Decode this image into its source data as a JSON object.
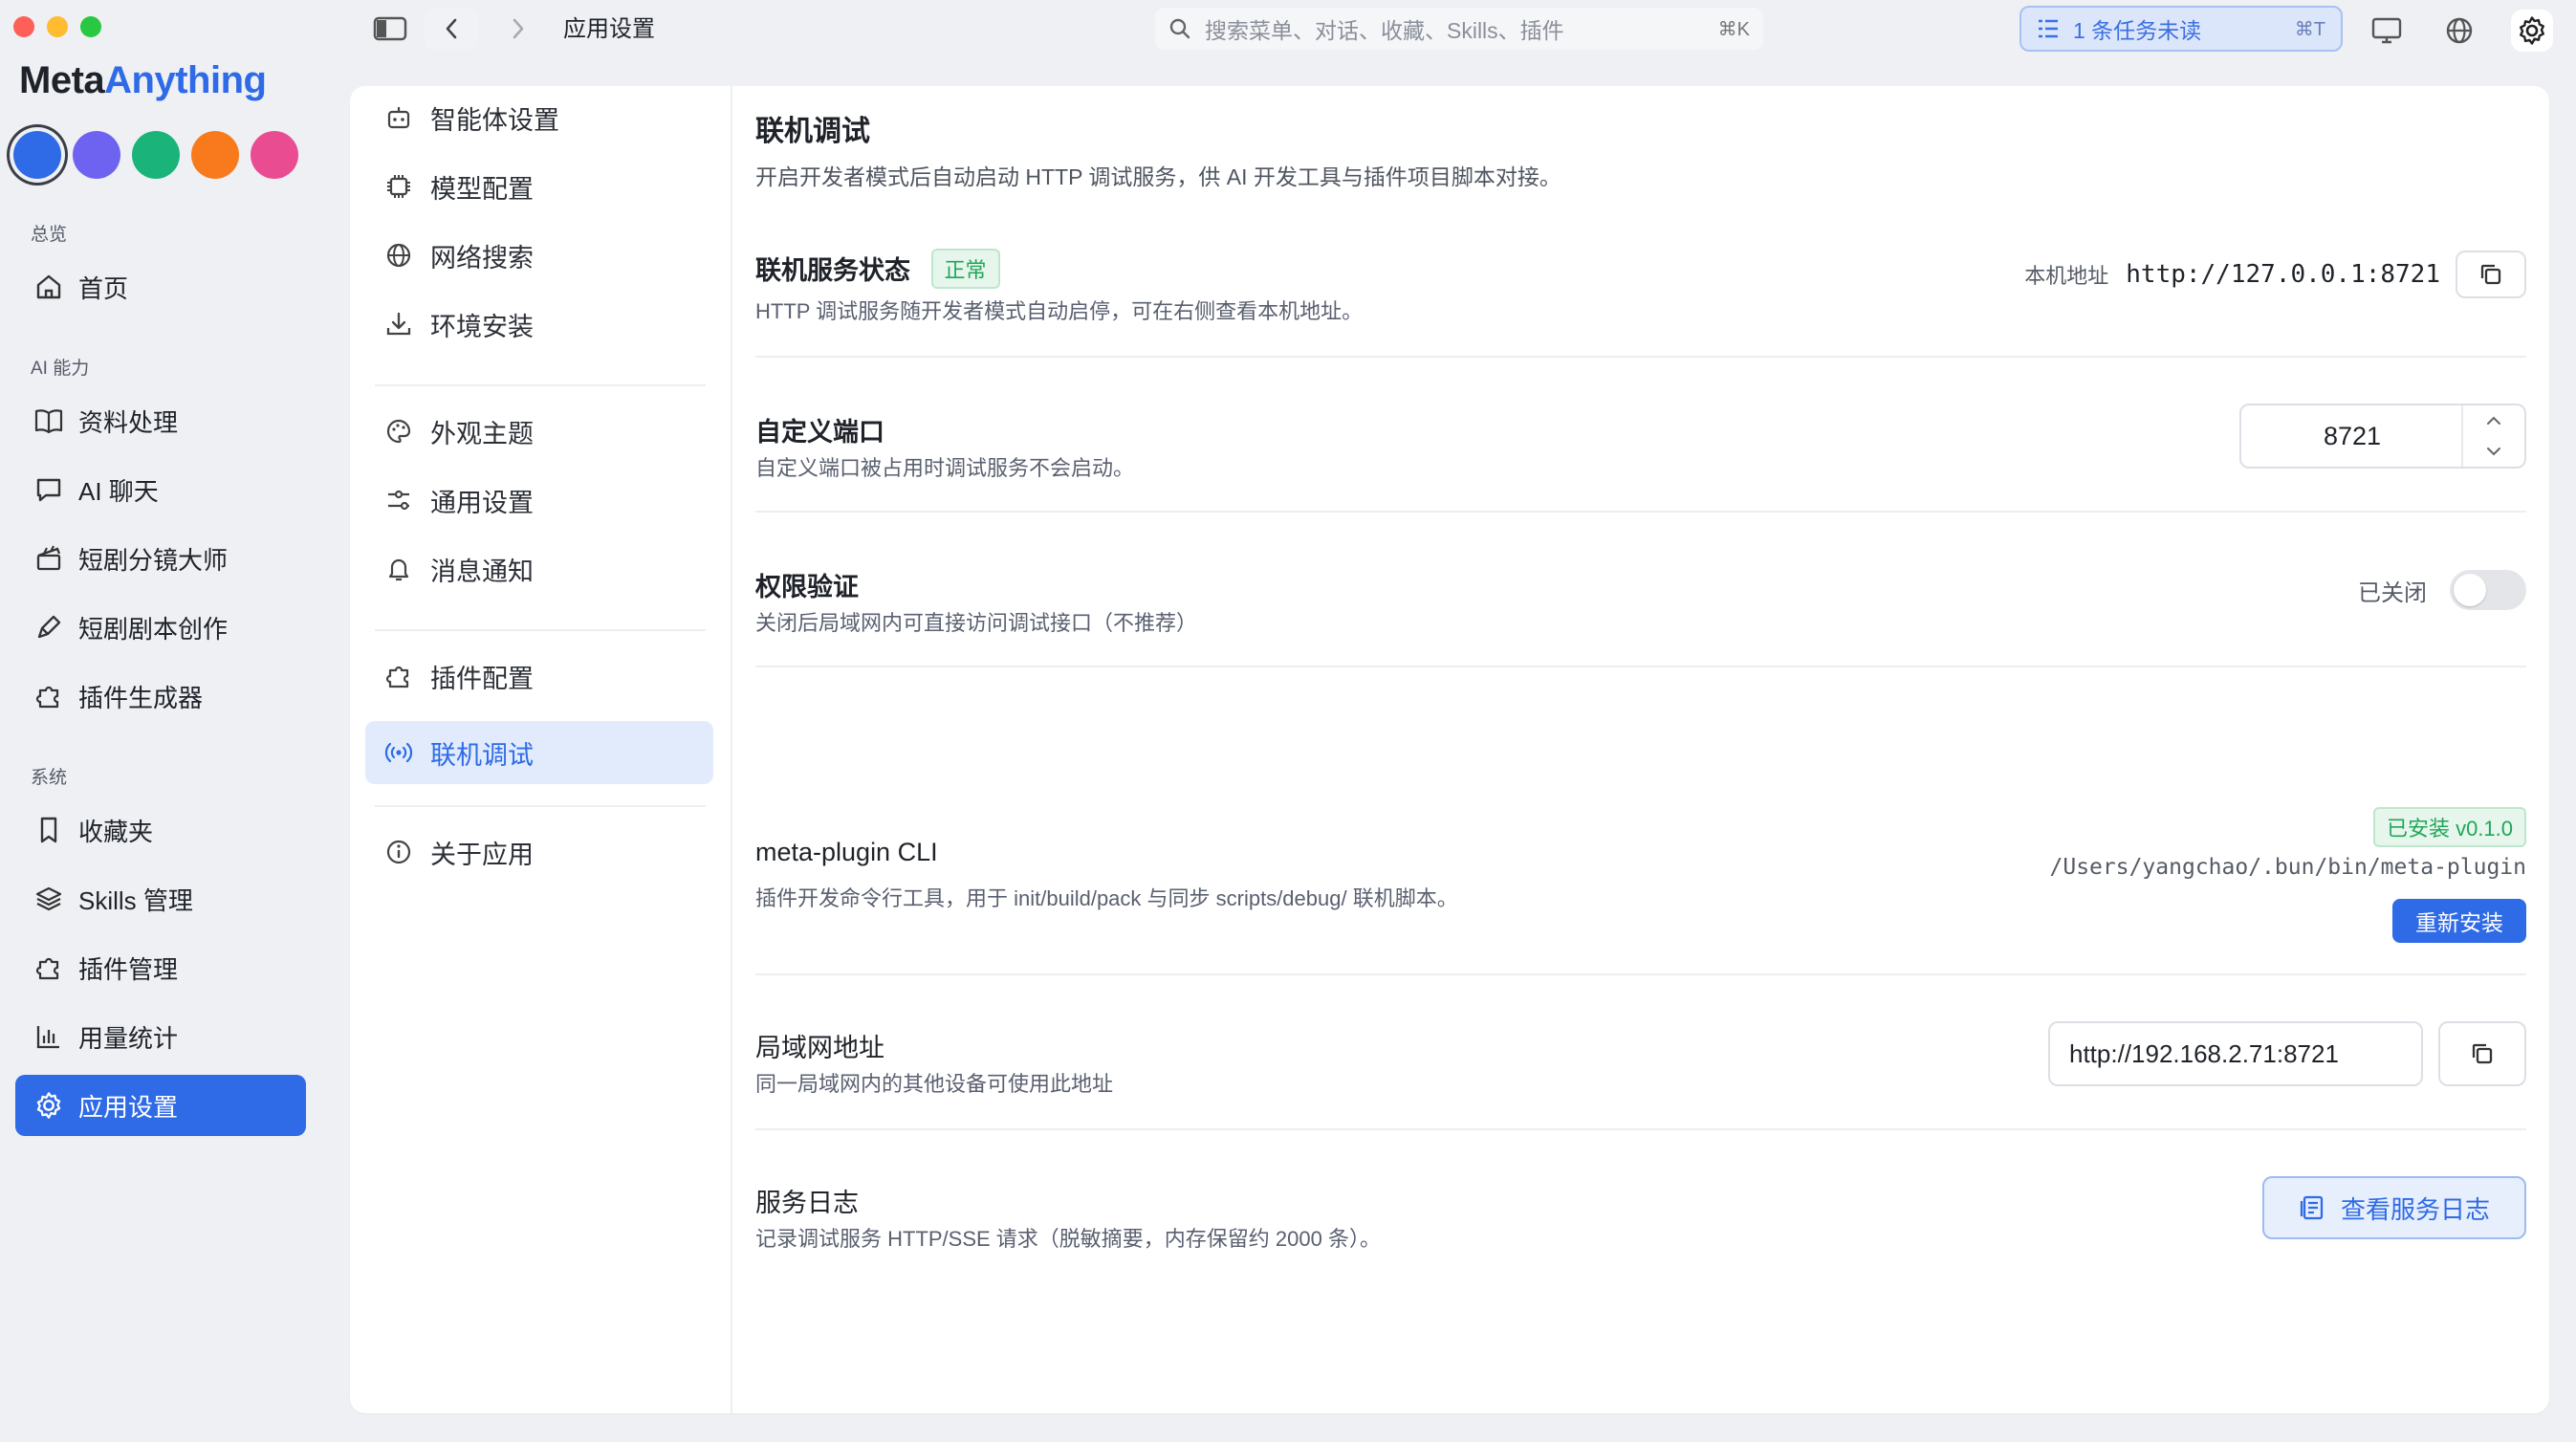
{
  "window": {
    "breadcrumb": "应用设置",
    "search_placeholder": "搜索菜单、对话、收藏、Skills、插件",
    "search_shortcut": "⌘K",
    "tasks_label": "1 条任务未读",
    "tasks_shortcut": "⌘T"
  },
  "brand": {
    "part1": "Meta",
    "part2": "Anything"
  },
  "theme_colors": [
    "#2f6be6",
    "#6e63f0",
    "#1ab37a",
    "#f97a1c",
    "#ea4c92"
  ],
  "sidebar": {
    "section_overview": "总览",
    "section_ai": "AI 能力",
    "section_system": "系统",
    "items": [
      {
        "label": "首页",
        "icon": "home-icon"
      },
      {
        "label": "资料处理",
        "icon": "book-icon"
      },
      {
        "label": "AI 聊天",
        "icon": "chat-icon"
      },
      {
        "label": "短剧分镜大师",
        "icon": "clapper-icon"
      },
      {
        "label": "短剧剧本创作",
        "icon": "pen-icon"
      },
      {
        "label": "插件生成器",
        "icon": "puzzle-icon"
      },
      {
        "label": "收藏夹",
        "icon": "bookmark-icon"
      },
      {
        "label": "Skills 管理",
        "icon": "layers-icon"
      },
      {
        "label": "插件管理",
        "icon": "puzzle-icon"
      },
      {
        "label": "用量统计",
        "icon": "bar-chart-icon"
      },
      {
        "label": "应用设置",
        "icon": "gear-icon",
        "active": true
      }
    ]
  },
  "settings_nav": {
    "items": [
      {
        "label": "智能体设置",
        "icon": "robot-icon"
      },
      {
        "label": "模型配置",
        "icon": "chip-icon"
      },
      {
        "label": "网络搜索",
        "icon": "globe-icon"
      },
      {
        "label": "环境安装",
        "icon": "download-icon"
      },
      {
        "label": "外观主题",
        "icon": "palette-icon"
      },
      {
        "label": "通用设置",
        "icon": "sliders-icon"
      },
      {
        "label": "消息通知",
        "icon": "bell-icon"
      },
      {
        "label": "插件配置",
        "icon": "puzzle-icon"
      },
      {
        "label": "联机调试",
        "icon": "broadcast-icon",
        "active": true
      },
      {
        "label": "关于应用",
        "icon": "info-icon"
      }
    ]
  },
  "page": {
    "title": "联机调试",
    "description": "开启开发者模式后自动启动 HTTP 调试服务，供 AI 开发工具与插件项目脚本对接。",
    "status": {
      "title": "联机服务状态",
      "badge": "正常",
      "desc": "HTTP 调试服务随开发者模式自动启停，可在右侧查看本机地址。",
      "addr_label": "本机地址",
      "addr_value": "http://127.0.0.1:8721"
    },
    "port": {
      "title": "自定义端口",
      "desc": "自定义端口被占用时调试服务不会启动。",
      "value": "8721"
    },
    "auth": {
      "title": "权限验证",
      "desc": "关闭后局域网内可直接访问调试接口（不推荐）",
      "state_label": "已关闭",
      "enabled": false
    },
    "cli": {
      "title": "meta-plugin CLI",
      "desc": "插件开发命令行工具，用于 init/build/pack 与同步 scripts/debug/ 联机脚本。",
      "badge": "已安装 v0.1.0",
      "path": "/Users/yangchao/.bun/bin/meta-plugin",
      "reinstall": "重新安装"
    },
    "lan": {
      "title": "局域网地址",
      "desc": "同一局域网内的其他设备可使用此地址",
      "value": "http://192.168.2.71:8721"
    },
    "logs": {
      "title": "服务日志",
      "desc": "记录调试服务 HTTP/SSE 请求（脱敏摘要，内存保留约 2000 条）。",
      "button": "查看服务日志"
    }
  }
}
